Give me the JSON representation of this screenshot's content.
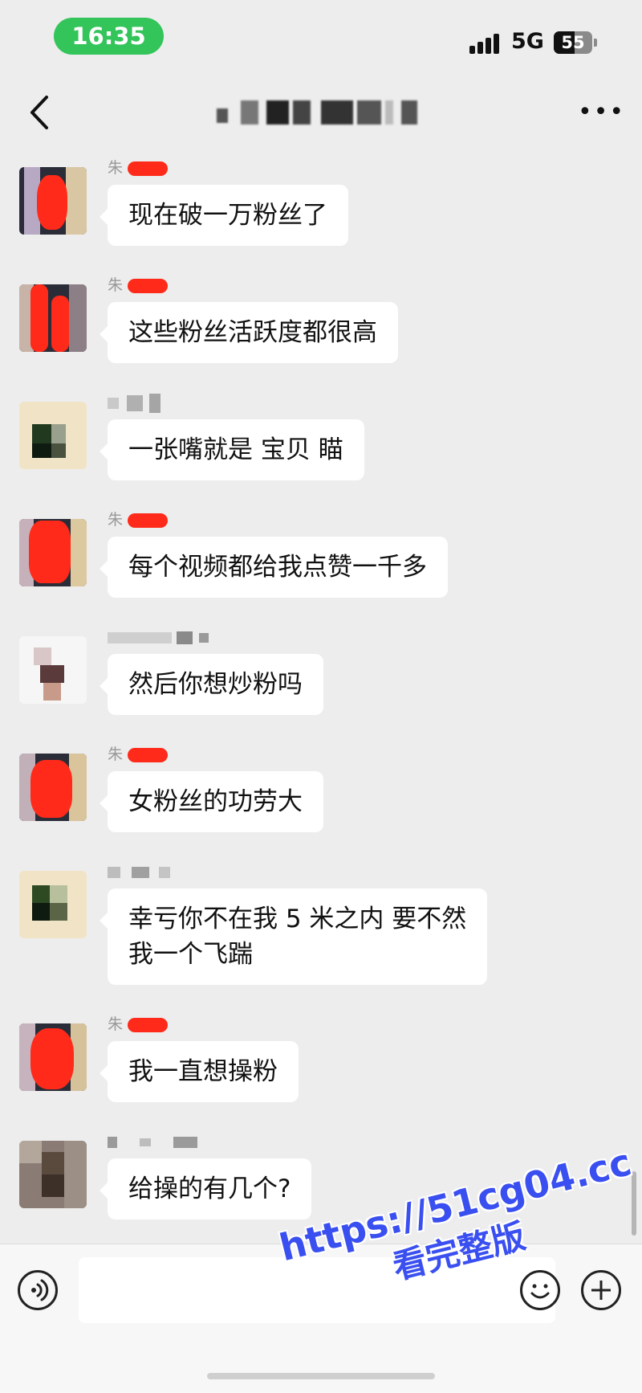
{
  "status_bar": {
    "time": "16:35",
    "network": "5G",
    "battery": "55"
  },
  "nav": {
    "back_icon": "chevron-left-icon",
    "more_icon": "more-horizontal-icon",
    "more_label": "•••"
  },
  "messages": [
    {
      "sender": "朱",
      "text": "现在破一万粉丝了"
    },
    {
      "sender": "朱",
      "text": "这些粉丝活跃度都很高"
    },
    {
      "sender": "",
      "text": "一张嘴就是 宝贝  瞄"
    },
    {
      "sender": "朱",
      "text": "每个视频都给我点赞一千多"
    },
    {
      "sender": "",
      "text": "然后你想炒粉吗"
    },
    {
      "sender": "朱",
      "text": "女粉丝的功劳大"
    },
    {
      "sender": "",
      "text": "幸亏你不在我 5 米之内   要不然\n我一个飞踹"
    },
    {
      "sender": "朱",
      "text": "我一直想操粉"
    },
    {
      "sender": "",
      "text": "给操的有几个?"
    }
  ],
  "input_bar": {
    "voice_icon": "voice-icon",
    "emoji_icon": "emoji-icon",
    "plus_icon": "plus-icon",
    "placeholder": ""
  },
  "watermark": {
    "url": "https://51cg04.cc",
    "subtitle": "看完整版"
  },
  "colors": {
    "background": "#ededed",
    "bubble": "#ffffff",
    "time_pill": "#33c45a",
    "redaction": "#ff2a1a",
    "watermark": "#3a4ff0"
  }
}
